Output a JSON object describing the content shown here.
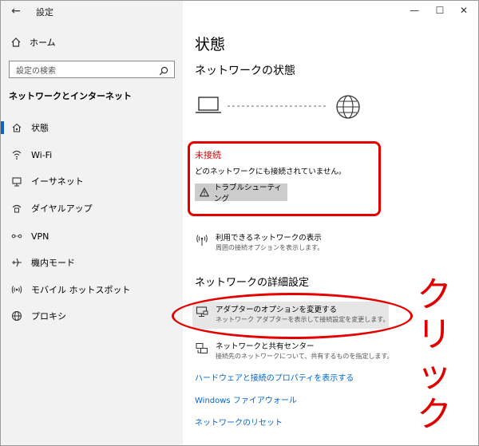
{
  "window": {
    "title": "設定",
    "controls": {
      "minimize": "—",
      "maximize": "☐",
      "close": "✕"
    }
  },
  "sidebar": {
    "home_label": "ホーム",
    "search_placeholder": "設定の検索",
    "section_title": "ネットワークとインターネット",
    "items": [
      {
        "label": "状態",
        "icon": "home-network-icon",
        "active": true
      },
      {
        "label": "Wi-Fi",
        "icon": "wifi-icon"
      },
      {
        "label": "イーサネット",
        "icon": "ethernet-icon"
      },
      {
        "label": "ダイヤルアップ",
        "icon": "dialup-icon"
      },
      {
        "label": "VPN",
        "icon": "vpn-icon"
      },
      {
        "label": "機内モード",
        "icon": "airplane-icon"
      },
      {
        "label": "モバイル ホットスポット",
        "icon": "hotspot-icon"
      },
      {
        "label": "プロキシ",
        "icon": "globe-icon"
      }
    ]
  },
  "main": {
    "title": "状態",
    "network_status_title": "ネットワークの状態",
    "status": {
      "label": "未接続",
      "description": "どのネットワークにも接続されていません。",
      "troubleshoot_button": "トラブルシューティング"
    },
    "available_networks": {
      "title": "利用できるネットワークの表示",
      "subtitle": "周囲の接続オプションを表示します。"
    },
    "advanced_title": "ネットワークの詳細設定",
    "adapter_options": {
      "title": "アダプターのオプションを変更する",
      "subtitle": "ネットワーク アダプターを表示して接続設定を変更します。"
    },
    "sharing_center": {
      "title": "ネットワークと共有センター",
      "subtitle": "接続先のネットワークについて、共有するものを指定します。"
    },
    "links": [
      "ハードウェアと接続のプロパティを表示する",
      "Windows ファイアウォール",
      "ネットワークのリセット"
    ]
  },
  "annotation": {
    "text": "クリック",
    "color": "#e00000"
  },
  "colors": {
    "accent": "#0a64c8",
    "error": "#d40000",
    "link": "#0066cc",
    "sidebar_bg": "#f2f2f2"
  }
}
